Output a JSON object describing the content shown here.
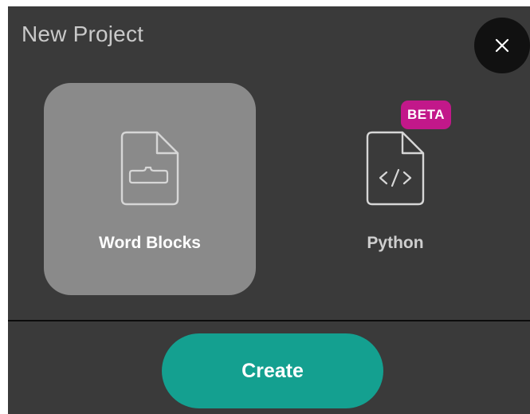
{
  "dialog": {
    "title": "New Project",
    "close_icon": "close-icon"
  },
  "project_types": [
    {
      "label": "Word Blocks",
      "icon": "word-blocks-file-icon",
      "selected": true
    },
    {
      "label": "Python",
      "icon": "code-file-icon",
      "selected": false,
      "badge": "BETA"
    }
  ],
  "footer": {
    "create_label": "Create"
  },
  "colors": {
    "dialog_bg": "#3a3a3a",
    "selected_card_bg": "#8a8a8a",
    "badge_bg": "#c2188a",
    "create_button_bg": "#14a090",
    "close_button_bg": "#111111"
  }
}
